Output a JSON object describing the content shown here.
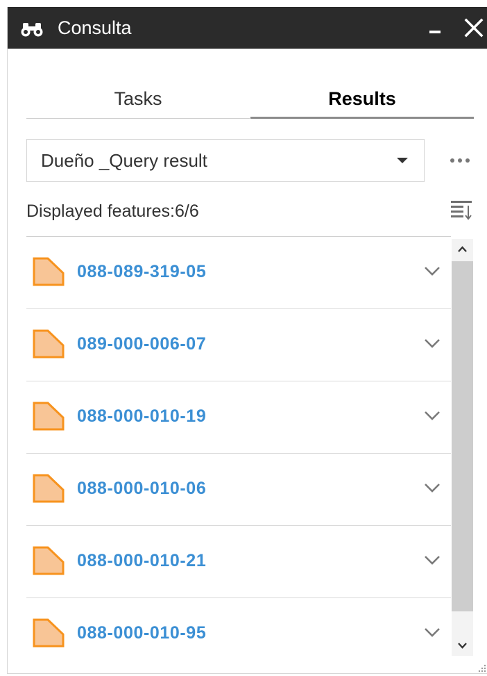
{
  "window": {
    "title": "Consulta",
    "title_icon": "binoculars-icon",
    "minimize_label": "minimize-icon",
    "close_label": "close-icon"
  },
  "tabs": [
    {
      "label": "Tasks",
      "active": false
    },
    {
      "label": "Results",
      "active": true
    }
  ],
  "layer_select": {
    "value": "Dueño _Query result",
    "icon": "caret-down-icon"
  },
  "more_menu": {
    "icon": "more-horizontal-icon"
  },
  "status": {
    "displayed_text": "Displayed features:6/6"
  },
  "sort": {
    "icon": "sort-icon"
  },
  "results": [
    {
      "label": "088-089-319-05",
      "icon": "polygon-icon"
    },
    {
      "label": "089-000-006-07",
      "icon": "polygon-icon"
    },
    {
      "label": "088-000-010-19",
      "icon": "polygon-icon"
    },
    {
      "label": "088-000-010-06",
      "icon": "polygon-icon"
    },
    {
      "label": "088-000-010-21",
      "icon": "polygon-icon"
    },
    {
      "label": "088-000-010-95",
      "icon": "polygon-icon"
    }
  ],
  "colors": {
    "titlebar_bg": "#2b2b2b",
    "link_blue": "#3b8fd4",
    "polygon_fill": "#f8c596",
    "polygon_stroke": "#f7931e",
    "scroll_thumb": "#cdcdcd"
  }
}
